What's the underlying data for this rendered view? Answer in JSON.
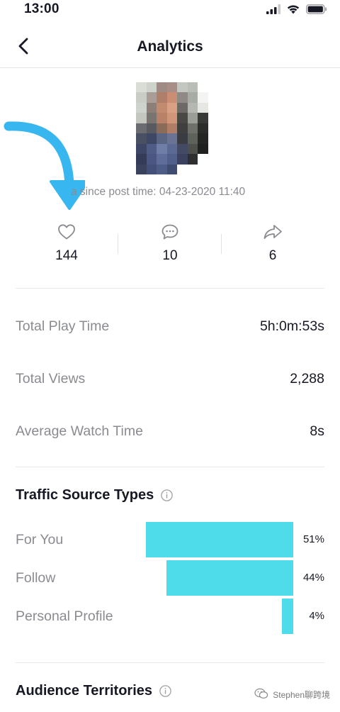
{
  "status_bar": {
    "time": "13:00",
    "icons": [
      "signal-icon",
      "wifi-icon",
      "battery-icon"
    ]
  },
  "nav": {
    "title": "Analytics",
    "back_icon": "chevron-left-icon"
  },
  "post": {
    "since_text": "a since post time: 04-23-2020 11:40"
  },
  "engagement": [
    {
      "icon": "heart-icon",
      "value": "144"
    },
    {
      "icon": "comment-icon",
      "value": "10"
    },
    {
      "icon": "share-icon",
      "value": "6"
    }
  ],
  "metrics": [
    {
      "label": "Total Play Time",
      "value": "5h:0m:53s"
    },
    {
      "label": "Total Views",
      "value": "2,288"
    },
    {
      "label": "Average Watch Time",
      "value": "8s"
    }
  ],
  "traffic": {
    "title": "Traffic Source Types",
    "sources": [
      {
        "label": "For You",
        "percent": "51%",
        "share": 0.51
      },
      {
        "label": "Follow",
        "percent": "44%",
        "share": 0.44
      },
      {
        "label": "Personal Profile",
        "percent": "4%",
        "share": 0.04
      }
    ]
  },
  "audience": {
    "title": "Audience Territories"
  },
  "watermark": {
    "text": "Stephen聊跨境"
  },
  "colors": {
    "bar": "#4fdcea",
    "arrow": "#38b6f0",
    "muted_text": "#8a8b91",
    "primary_text": "#161823"
  }
}
